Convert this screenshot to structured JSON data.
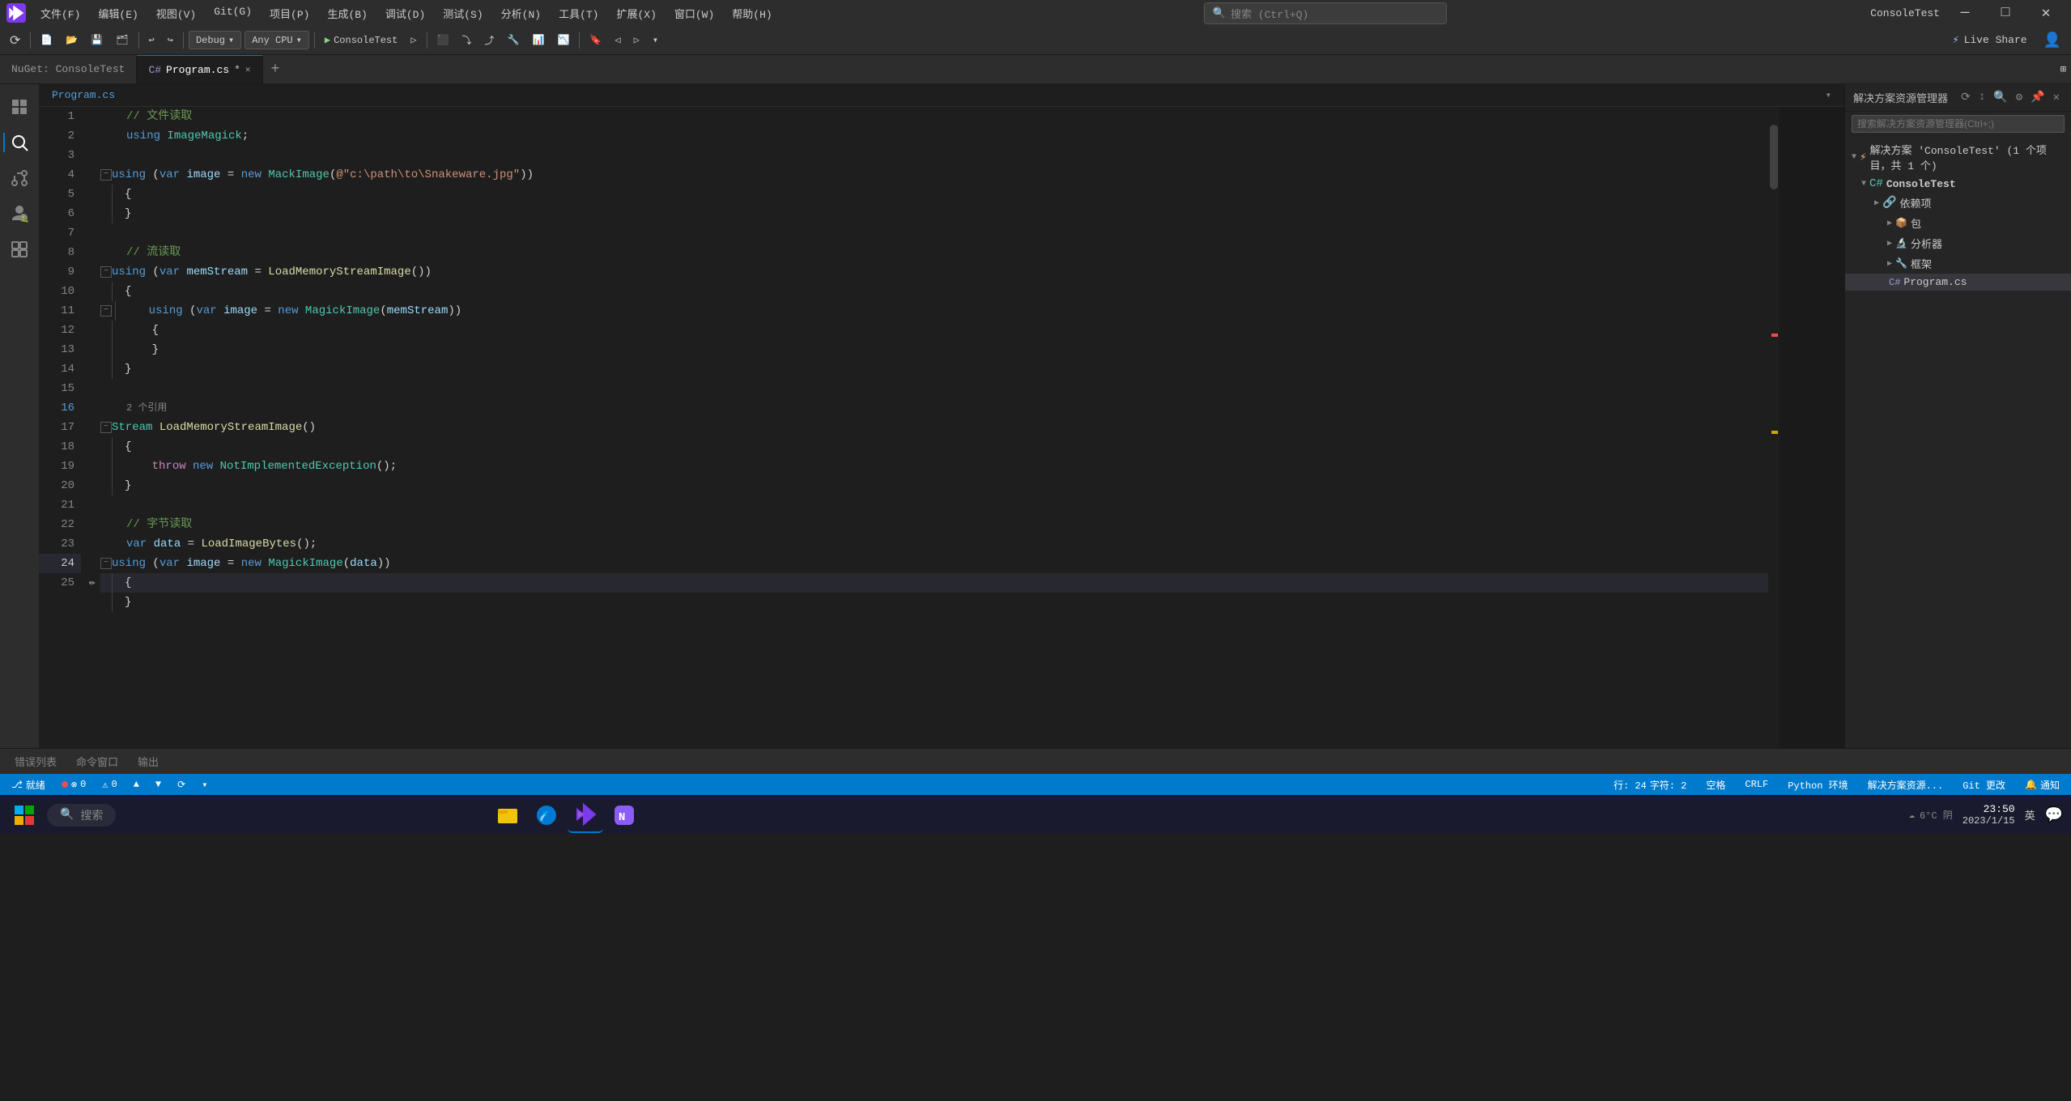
{
  "titlebar": {
    "logo": "VS",
    "menus": [
      "文件(F)",
      "编辑(E)",
      "视图(V)",
      "Git(G)",
      "项目(P)",
      "生成(B)",
      "调试(D)",
      "测试(S)",
      "分析(N)",
      "工具(T)",
      "扩展(X)",
      "窗口(W)",
      "帮助(H)"
    ],
    "search_placeholder": "搜索 (Ctrl+Q)",
    "app_name": "ConsoleTest",
    "minimize": "—",
    "maximize": "□",
    "close": "✕"
  },
  "toolbar": {
    "debug_config": "Debug",
    "platform": "Any CPU",
    "run_label": "ConsoleTest",
    "live_share": "Live Share"
  },
  "tabs": {
    "inactive": "NuGet: ConsoleTest",
    "active": "Program.cs",
    "active_modified": true
  },
  "code_header_left": "Program.cs",
  "code_header_right": "",
  "code_lines": [
    {
      "num": 1,
      "indent": 2,
      "content": "// 文件读取",
      "type": "comment"
    },
    {
      "num": 2,
      "indent": 2,
      "content": "using ImageMagick;",
      "type": "code"
    },
    {
      "num": 3,
      "indent": 0,
      "content": "",
      "type": "empty"
    },
    {
      "num": 4,
      "indent": 0,
      "content": "using (var image = new MackImage(@\"c:\\path\\to\\Snakeware.jpg\"))",
      "type": "code",
      "collapsible": true
    },
    {
      "num": 5,
      "indent": 1,
      "content": "{",
      "type": "code"
    },
    {
      "num": 6,
      "indent": 1,
      "content": "}",
      "type": "code"
    },
    {
      "num": 7,
      "indent": 0,
      "content": "",
      "type": "empty"
    },
    {
      "num": 8,
      "indent": 2,
      "content": "// 流读取",
      "type": "comment"
    },
    {
      "num": 9,
      "indent": 0,
      "content": "using (var memStream = LoadMemoryStreamImage())",
      "type": "code",
      "collapsible": true
    },
    {
      "num": 10,
      "indent": 1,
      "content": "{",
      "type": "code"
    },
    {
      "num": 11,
      "indent": 1,
      "content": "    using (var image = new MagickImage(memStream))",
      "type": "code",
      "collapsible": true
    },
    {
      "num": 12,
      "indent": 2,
      "content": "    {",
      "type": "code"
    },
    {
      "num": 13,
      "indent": 2,
      "content": "    }",
      "type": "code"
    },
    {
      "num": 14,
      "indent": 1,
      "content": "}",
      "type": "code"
    },
    {
      "num": 15,
      "indent": 0,
      "content": "",
      "type": "empty"
    },
    {
      "num": 16,
      "indent": 0,
      "content": "Stream LoadMemoryStreamImage()",
      "type": "code",
      "collapsible": true,
      "refs": "2 个引用"
    },
    {
      "num": 17,
      "indent": 1,
      "content": "{",
      "type": "code"
    },
    {
      "num": 18,
      "indent": 2,
      "content": "    throw new NotImplementedException();",
      "type": "code"
    },
    {
      "num": 19,
      "indent": 1,
      "content": "}",
      "type": "code"
    },
    {
      "num": 20,
      "indent": 0,
      "content": "",
      "type": "empty"
    },
    {
      "num": 21,
      "indent": 2,
      "content": "// 字节读取",
      "type": "comment"
    },
    {
      "num": 22,
      "indent": 2,
      "content": "var data = LoadImageBytes();",
      "type": "code"
    },
    {
      "num": 23,
      "indent": 0,
      "content": "using (var image = new MagickImage(data))",
      "type": "code",
      "collapsible": true
    },
    {
      "num": 24,
      "indent": 1,
      "content": "{",
      "type": "code",
      "current": true
    },
    {
      "num": 25,
      "indent": 1,
      "content": "}",
      "type": "code"
    }
  ],
  "solution_explorer": {
    "title": "解决方案资源管理器",
    "search_placeholder": "搜索解决方案资源管理器(Ctrl+;)",
    "solution_label": "解决方案 'ConsoleTest' (1 个项目，共 1 个)",
    "project": "ConsoleTest",
    "deps_label": "依赖项",
    "packages_label": "包",
    "analyzers_label": "分析器",
    "framework_label": "框架",
    "file_label": "Program.cs"
  },
  "status_bar": {
    "branch": "就绪",
    "errors": "0",
    "warnings": "0",
    "line": "行: 24",
    "col": "字符: 2",
    "spaces": "空格",
    "encoding": "CRLF",
    "lang": "Python 环境",
    "explorer": "解决方案资源...",
    "git": "Git 更改",
    "notifications": "通知"
  },
  "bottom_panel": {
    "tabs": [
      "错误列表",
      "命令窗口",
      "输出"
    ]
  },
  "taskbar": {
    "search_label": "搜索",
    "clock": "23:50",
    "date": "2023/1/15",
    "weather": "6°C 阴",
    "lang_indicator": "英"
  }
}
